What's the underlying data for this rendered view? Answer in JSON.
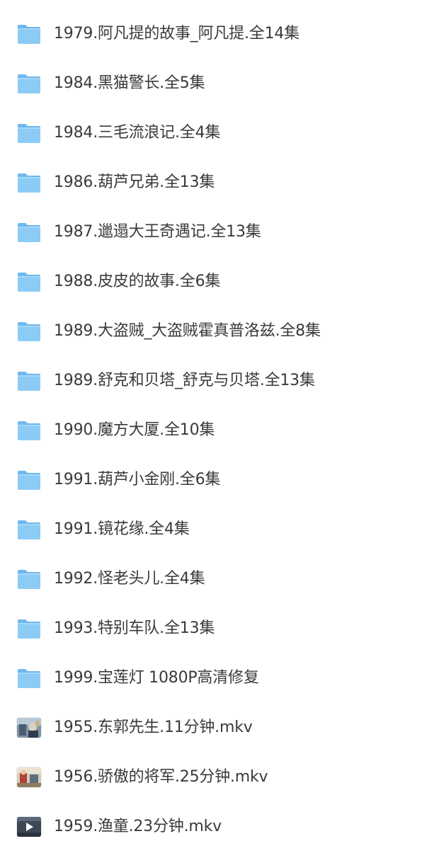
{
  "items": [
    {
      "type": "folder",
      "icon": "folder-icon",
      "name": "1979.阿凡提的故事_阿凡提.全14集"
    },
    {
      "type": "folder",
      "icon": "folder-icon",
      "name": "1984.黑猫警长.全5集"
    },
    {
      "type": "folder",
      "icon": "folder-icon",
      "name": "1984.三毛流浪记.全4集"
    },
    {
      "type": "folder",
      "icon": "folder-icon",
      "name": "1986.葫芦兄弟.全13集"
    },
    {
      "type": "folder",
      "icon": "folder-icon",
      "name": "1987.邋遢大王奇遇记.全13集"
    },
    {
      "type": "folder",
      "icon": "folder-icon",
      "name": "1988.皮皮的故事.全6集"
    },
    {
      "type": "folder",
      "icon": "folder-icon",
      "name": "1989.大盗贼_大盗贼霍真普洛兹.全8集"
    },
    {
      "type": "folder",
      "icon": "folder-icon",
      "name": "1989.舒克和贝塔_舒克与贝塔.全13集"
    },
    {
      "type": "folder",
      "icon": "folder-icon",
      "name": "1990.魔方大厦.全10集"
    },
    {
      "type": "folder",
      "icon": "folder-icon",
      "name": "1991.葫芦小金刚.全6集"
    },
    {
      "type": "folder",
      "icon": "folder-icon",
      "name": "1991.镜花缘.全4集"
    },
    {
      "type": "folder",
      "icon": "folder-icon",
      "name": "1992.怪老头儿.全4集"
    },
    {
      "type": "folder",
      "icon": "folder-icon",
      "name": "1993.特别车队.全13集"
    },
    {
      "type": "folder",
      "icon": "folder-icon",
      "name": "1999.宝莲灯 1080P高清修复"
    },
    {
      "type": "video",
      "icon": "video-thumbnail-icon",
      "name": "1955.东郭先生.11分钟.mkv"
    },
    {
      "type": "video",
      "icon": "video-thumbnail-icon",
      "name": "1956.骄傲的将军.25分钟.mkv"
    },
    {
      "type": "video",
      "icon": "video-thumbnail-icon",
      "name": "1959.渔童.23分钟.mkv"
    }
  ],
  "colors": {
    "folder_body": "#8ccbf5",
    "folder_tab": "#6fb8ee",
    "text": "#3a3a3a"
  }
}
